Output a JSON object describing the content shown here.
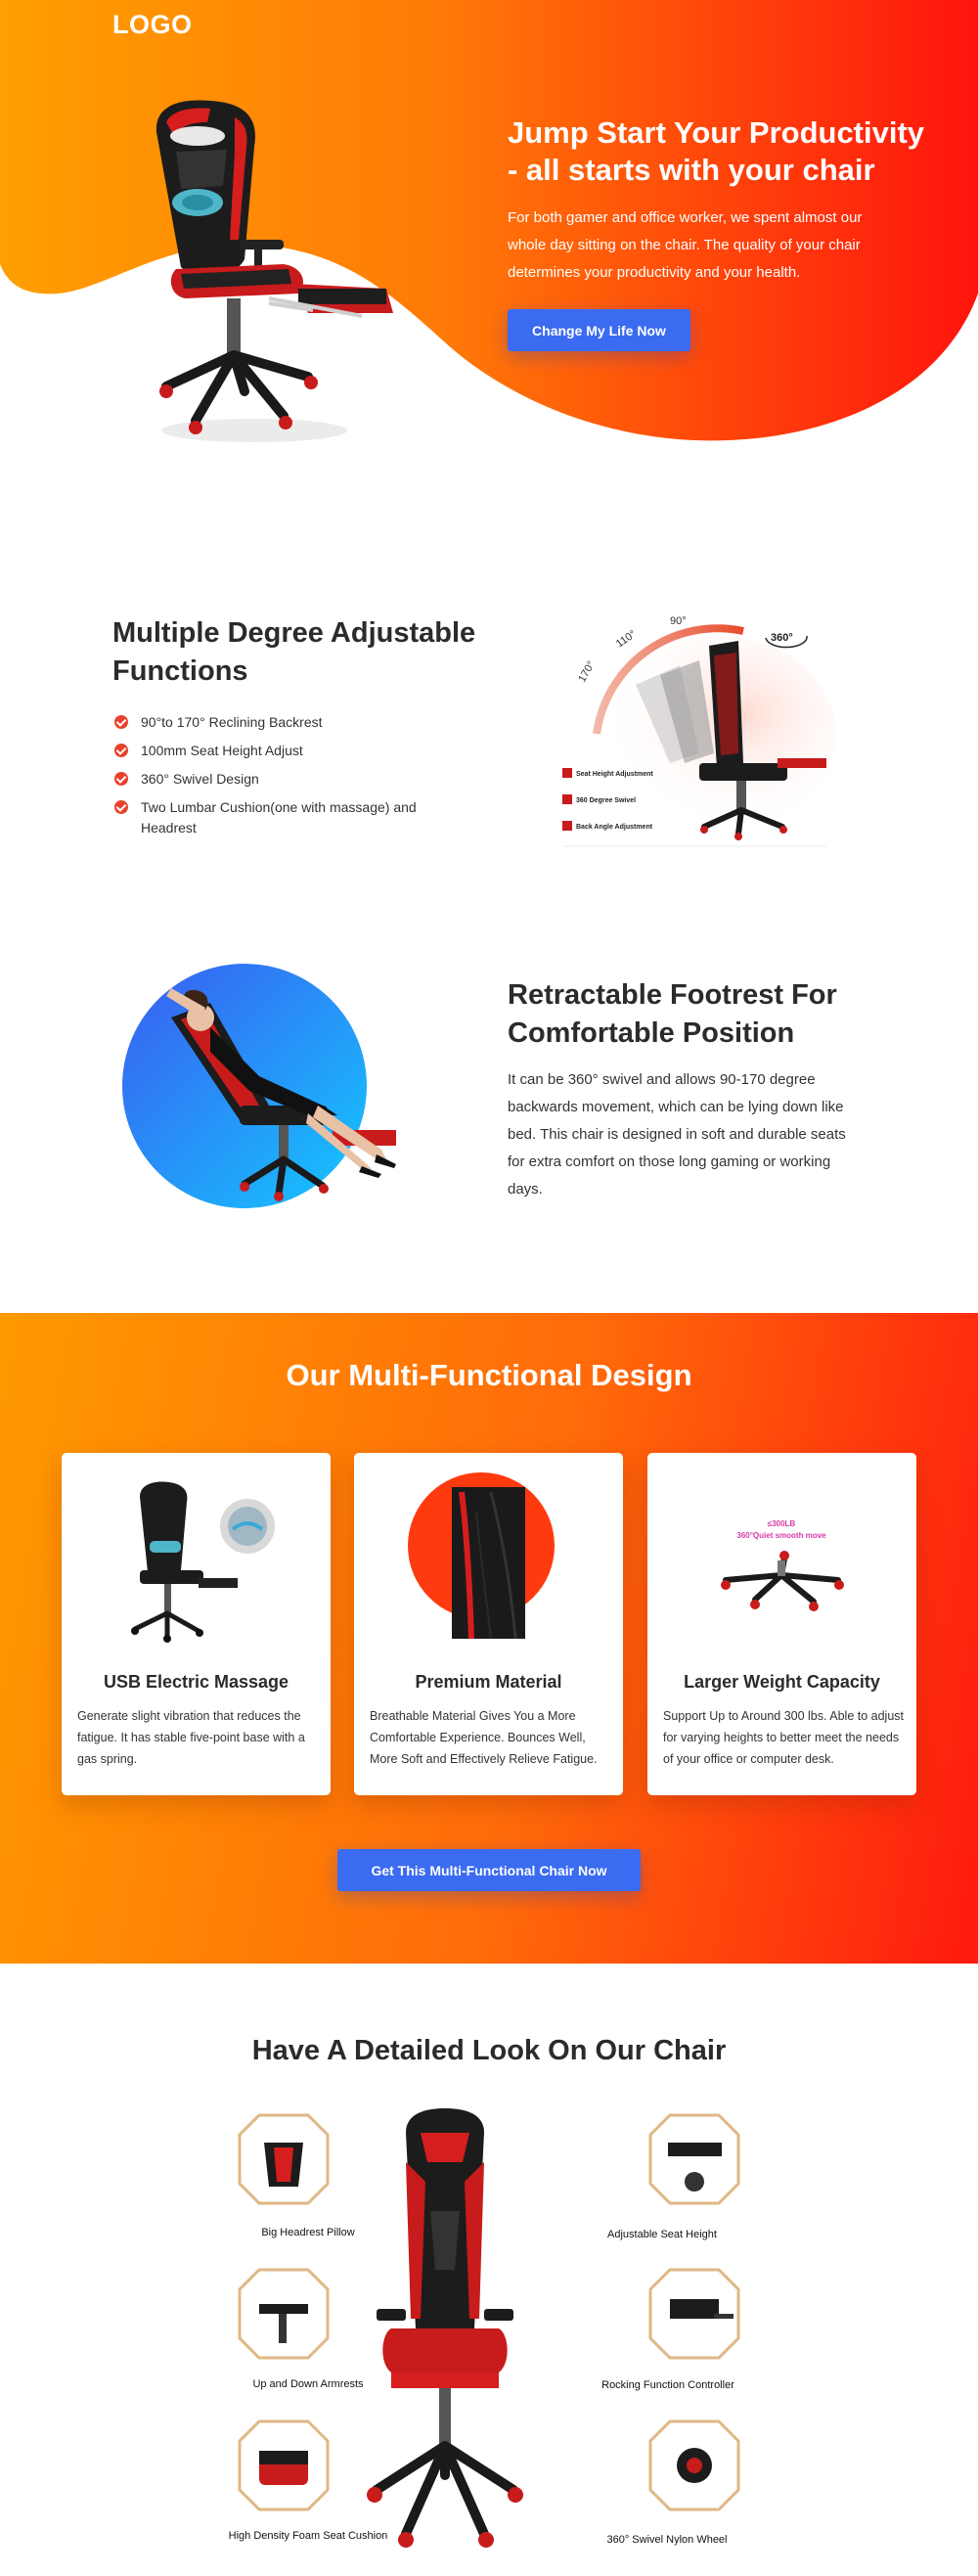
{
  "hero": {
    "logo": "LOGO",
    "title": "Jump Start Your Productivity - all starts with your chair",
    "text": "For both gamer and office worker,  we spent almost our whole day sitting on the chair.  The quality of your chair determines your productivity and your health.",
    "button": "Change My Life Now"
  },
  "feature1": {
    "title": "Multiple Degree Adjustable Functions",
    "items": [
      "90°to 170° Reclining Backrest",
      "100mm Seat Height Adjust",
      "360° Swivel Design",
      "Two Lumbar Cushion(one with massage) and Headrest"
    ],
    "diagram": {
      "angle_170": "170°",
      "angle_110": "110°",
      "angle_90": "90°",
      "swivel": "360°",
      "seat_height": "Seat Height Adjustment",
      "swivel_label": "360 Degree Swivel",
      "back_angle": "Back Angle Adjustment"
    }
  },
  "feature2": {
    "title": "Retractable Footrest For Comfortable Position",
    "text": "It can be 360° swivel and allows 90-170 degree backwards movement, which can be lying down like bed. This chair is designed in soft and durable seats for extra comfort on those long gaming or working days."
  },
  "multi": {
    "title": "Our Multi-Functional Design",
    "cards": [
      {
        "title": "USB Electric Massage",
        "text": "Generate slight vibration that reduces the fatigue. It has stable five-point base with a gas spring."
      },
      {
        "title": "Premium Material",
        "text": "Breathable Material Gives You a More Comfortable Experience. Bounces Well, More Soft and Effectively Relieve Fatigue."
      },
      {
        "title": "Larger Weight Capacity",
        "text": "Support Up to Around 300 lbs. Able to adjust for varying heights to better meet the needs of your office or computer desk."
      }
    ],
    "capacity_badge_1": "≤300LB",
    "capacity_badge_2": "360°Quiet smooth move",
    "button": "Get This Multi-Functional Chair Now"
  },
  "detail": {
    "title": "Have A Detailed Look On Our Chair",
    "labels": [
      "Big Headrest Pillow",
      "Adjustable Seat Height",
      "Up and Down Armrests",
      "Rocking Function Controller",
      "High Density Foam Seat Cushion",
      "360° Swivel Nylon Wheel"
    ]
  },
  "colors": {
    "hero_orange": "#ff9800",
    "hero_red": "#ff1a0e",
    "button_blue": "#3a6bf0",
    "check_red": "#e8412c",
    "circle_blue": "#1ea0ff"
  }
}
